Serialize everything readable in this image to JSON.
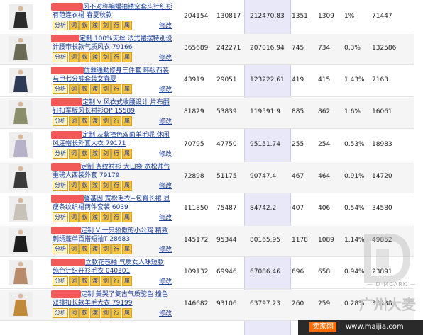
{
  "rows": [
    {
      "title1": "风不对称蝙蝠袖镂空套头针织衫",
      "title2": "有范连衣裙 春夏秋款",
      "c1": "204154",
      "c2": "130817",
      "c3": "212470.83",
      "c4": "1351",
      "c5": "1309",
      "c6": "1%",
      "c7": "71447",
      "redactW": 45
    },
    {
      "title1": "定制 100%天丝 法式裙摆特别设",
      "title2": "计腰带长款气质风衣 79166",
      "c1": "365689",
      "c2": "242271",
      "c3": "207016.94",
      "c4": "745",
      "c5": "734",
      "c6": "0.3%",
      "c7": "132586",
      "redactW": 40
    },
    {
      "title1": "优雅通勤修身三件套 韩版西装",
      "title2": "马甲七分裤套装女春夏",
      "c1": "43919",
      "c2": "29051",
      "c3": "123222.61",
      "c4": "419",
      "c5": "415",
      "c6": "1.43%",
      "c7": "7163",
      "redactW": 46
    },
    {
      "title1": "定制 V 风衣式收腰设计 片布翻",
      "title2": "钉扣军版风长衬衫OP 15589",
      "c1": "81829",
      "c2": "53839",
      "c3": "119591.9",
      "c4": "885",
      "c5": "862",
      "c6": "1.6%",
      "c7": "16061",
      "redactW": 44
    },
    {
      "title1": "定制 灰紫撞色双面羊毛呢 休闲",
      "title2": "风连帽长外套大衣 79171",
      "c1": "70795",
      "c2": "47750",
      "c3": "95151.74",
      "c4": "255",
      "c5": "254",
      "c6": "0.53%",
      "c7": "18983",
      "redactW": 44
    },
    {
      "title1": "定制 条纹衬衫 大口袋 宽松帅气",
      "title2": "重磅大西装外套 79179",
      "c1": "72898",
      "c2": "51175",
      "c3": "90747.4",
      "c4": "467",
      "c5": "464",
      "c6": "0.91%",
      "c7": "14720",
      "redactW": 42
    },
    {
      "title1": "馨基因 宽松毛衣+包臀长裙 显",
      "title2": "瘦条纹织裙两件套装 6039",
      "c1": "111850",
      "c2": "75487",
      "c3": "84742.2",
      "c4": "407",
      "c5": "406",
      "c6": "0.54%",
      "c7": "34580",
      "redactW": 46
    },
    {
      "title1": "定制 V 一只骄傲的小公鸡 精致",
      "title2": "刺绣蓬单百搭短袖T 28683",
      "c1": "145172",
      "c2": "95344",
      "c3": "80165.95",
      "c4": "1178",
      "c5": "1089",
      "c6": "1.14%",
      "c7": "49852",
      "redactW": 42
    },
    {
      "title1": "立款花苞袖 气质女人味短款",
      "title2": "纯色针织开衫毛衣 040301",
      "c1": "109132",
      "c2": "69946",
      "c3": "67086.46",
      "c4": "696",
      "c5": "658",
      "c6": "0.94%",
      "c7": "23891",
      "redactW": 48
    },
    {
      "title1": "定制 美哭了复古气质驼色 撞色",
      "title2": "双排扣长款羊毛大衣 79199",
      "c1": "146682",
      "c2": "93106",
      "c3": "63797.23",
      "c4": "260",
      "c5": "259",
      "c6": "0.28%",
      "c7": "38438",
      "redactW": 42
    }
  ],
  "tags": [
    "分析",
    "词",
    "款",
    "渡",
    "剑",
    "行",
    "属"
  ],
  "modify_label": "修改",
  "watermark": {
    "brand": "— D·MCARK —",
    "city": "广州大麦"
  },
  "footer": {
    "logo": "卖家网",
    "url": "www.maijia.com"
  },
  "colors": {
    "link": "#1a3d9a",
    "tag": "#f5c242",
    "redact": "#f25a5a",
    "highlight": "#e8e8f8"
  }
}
